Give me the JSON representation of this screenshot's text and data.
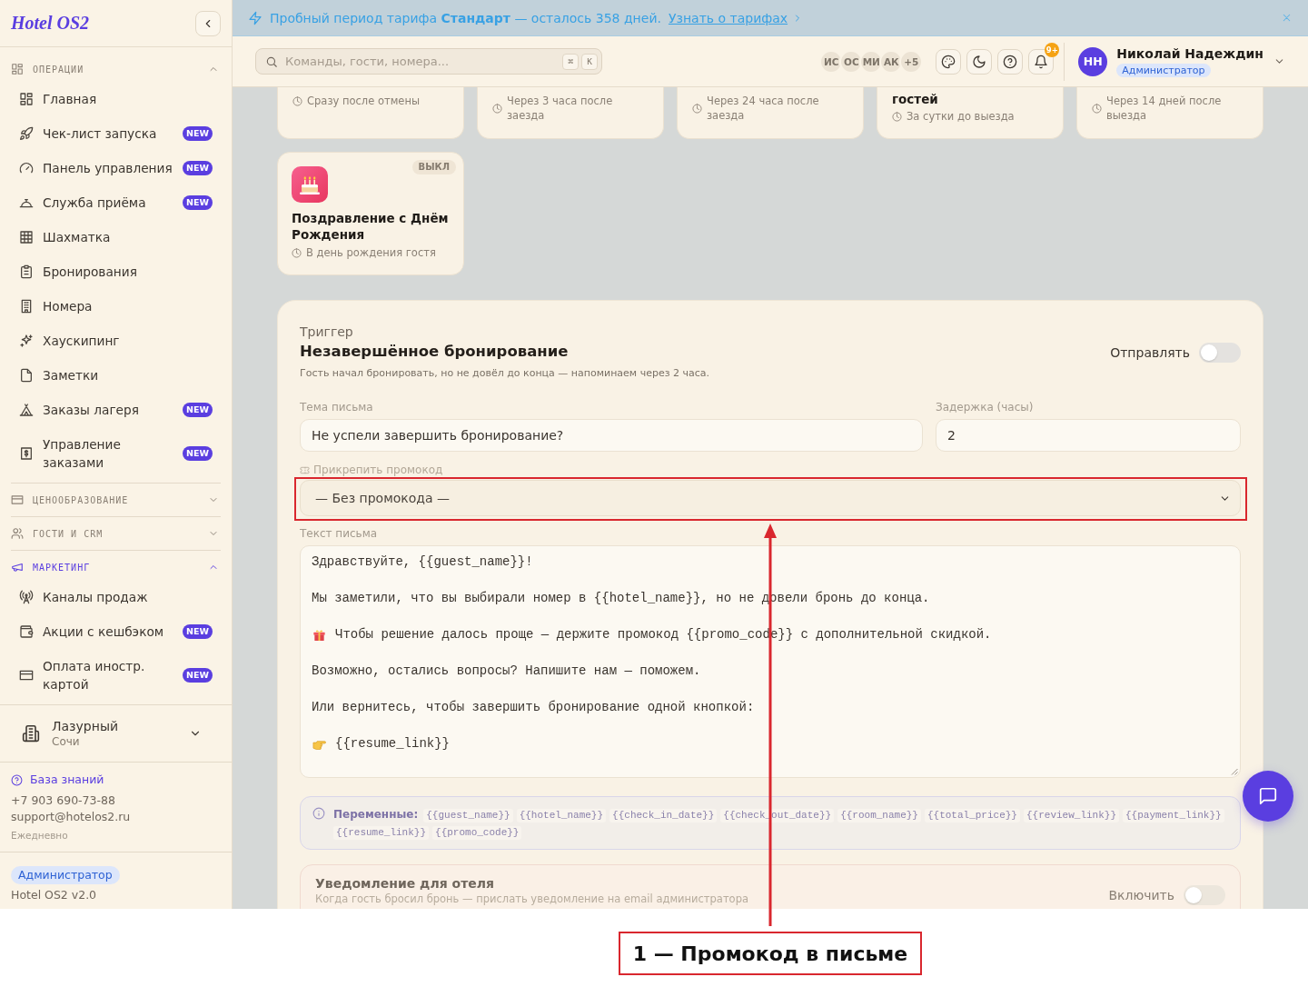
{
  "sidebar": {
    "logo": "Hotel OS2",
    "sections": [
      {
        "title": "ОПЕРАЦИИ",
        "expanded": true,
        "active": false,
        "items": [
          {
            "label": "Главная",
            "selected": false
          },
          {
            "label": "Чек-лист запуска",
            "badge": "NEW",
            "selected": false
          },
          {
            "label": "Панель управления",
            "badge": "NEW",
            "selected": false
          },
          {
            "label": "Служба приёма",
            "badge": "NEW",
            "selected": false
          },
          {
            "label": "Шахматка",
            "selected": false
          },
          {
            "label": "Бронирования",
            "selected": false
          },
          {
            "label": "Номера",
            "selected": false
          },
          {
            "label": "Хаускипинг",
            "selected": false
          },
          {
            "label": "Заметки",
            "selected": false
          },
          {
            "label": "Заказы лагеря",
            "badge": "NEW",
            "selected": false
          },
          {
            "label": "Управление заказами",
            "badge": "NEW",
            "selected": false
          }
        ]
      },
      {
        "title": "ЦЕНООБРАЗОВАНИЕ",
        "expanded": false,
        "active": false
      },
      {
        "title": "ГОСТИ И CRM",
        "expanded": false,
        "active": false
      },
      {
        "title": "МАРКЕТИНГ",
        "expanded": true,
        "active": true,
        "items": [
          {
            "label": "Каналы продаж",
            "selected": false
          },
          {
            "label": "Акции с кешбэком",
            "badge": "NEW",
            "selected": false
          },
          {
            "label": "Оплата иностр. картой",
            "badge": "NEW",
            "selected": false
          }
        ]
      }
    ],
    "hotel": {
      "name": "Лазурный",
      "city": "Сочи"
    },
    "support": {
      "link": "База знаний",
      "phone": "+7 903 690-73-88",
      "email": "support@hotelos2.ru",
      "hours": "Ежедневно"
    },
    "footer": {
      "role": "Администратор",
      "version": "Hotel OS2 v2.0"
    }
  },
  "banner": {
    "text": "Пробный период тарифа **Стандарт** — осталось 358 дней.",
    "link": "Узнать о тарифах"
  },
  "topbar": {
    "search": {
      "placeholder": "Команды, гости, номера...",
      "keys": [
        "⌘",
        "K"
      ]
    },
    "team": [
      {
        "initials": "ИС"
      },
      {
        "initials": "ОС"
      },
      {
        "initials": "МИ"
      },
      {
        "initials": "АК"
      }
    ],
    "team_more": "+5",
    "notifications": "9+",
    "user": {
      "initials": "НН",
      "name": "Николай Надеждин",
      "role": "Администратор"
    }
  },
  "template_cards": [
    {
      "kind": "clipped",
      "timing": "Сразу после отмены"
    },
    {
      "kind": "clipped",
      "timing": "Через 3 часа после заезда"
    },
    {
      "kind": "clipped",
      "timing": "Через 24 часа после заезда"
    },
    {
      "kind": "clipped",
      "title": "гостей",
      "timing": "За сутки до выезда"
    },
    {
      "kind": "clipped",
      "timing": "Через 14 дней после выезда"
    },
    {
      "kind": "full",
      "title": "Поздравление с Днём Рождения",
      "timing": "В день рождения гостя",
      "status": "ВЫКЛ",
      "enabled": false
    }
  ],
  "trigger": {
    "label": "Триггер",
    "title": "Незавершённое бронирование",
    "description": "Гость начал бронировать, но не довёл до конца — напоминаем через 2 часа.",
    "send": {
      "label": "Отправлять",
      "on": false
    },
    "subject": {
      "label": "Тема письма",
      "value": "Не успели завершить бронирование?"
    },
    "delay": {
      "label": "Задержка (часы)",
      "value": "2"
    },
    "promo": {
      "label": "Прикрепить промокод",
      "value": "— Без промокода —"
    },
    "body": {
      "label": "Текст письма",
      "paragraphs": [
        {
          "kind": "plain",
          "text": "Здравствуйте, {{guest_name}}!"
        },
        {
          "kind": "plain",
          "text": "Мы заметили, что вы выбирали номер в {{hotel_name}}, но не довели бронь до конца."
        },
        {
          "kind": "emoji",
          "text": "Чтобы решение далось проще — держите промокод {{promo_code}} с дополнительной скидкой."
        },
        {
          "kind": "plain",
          "text": "Возможно, остались вопросы? Напишите нам — поможем."
        },
        {
          "kind": "plain",
          "text": "Или вернитесь, чтобы завершить бронирование одной кнопкой:"
        },
        {
          "kind": "emoji",
          "text": "{{resume_link}}"
        }
      ]
    },
    "variables": {
      "label": "Переменные:",
      "items": [
        "{{guest_name}}",
        "{{hotel_name}}",
        "{{check_in_date}}",
        "{{check_out_date}}",
        "{{room_name}}",
        "{{total_price}}",
        "{{review_link}}",
        "{{payment_link}}",
        "{{resume_link}}",
        "{{promo_code}}"
      ]
    },
    "hotel_notice": {
      "title": "Уведомление для отеля",
      "description": "Когда гость бросил бронь — прислать уведомление на email администратора",
      "toggle": {
        "label": "Включить",
        "on": false
      }
    }
  },
  "annotation": {
    "caption": "1 — Промокод в письме"
  }
}
